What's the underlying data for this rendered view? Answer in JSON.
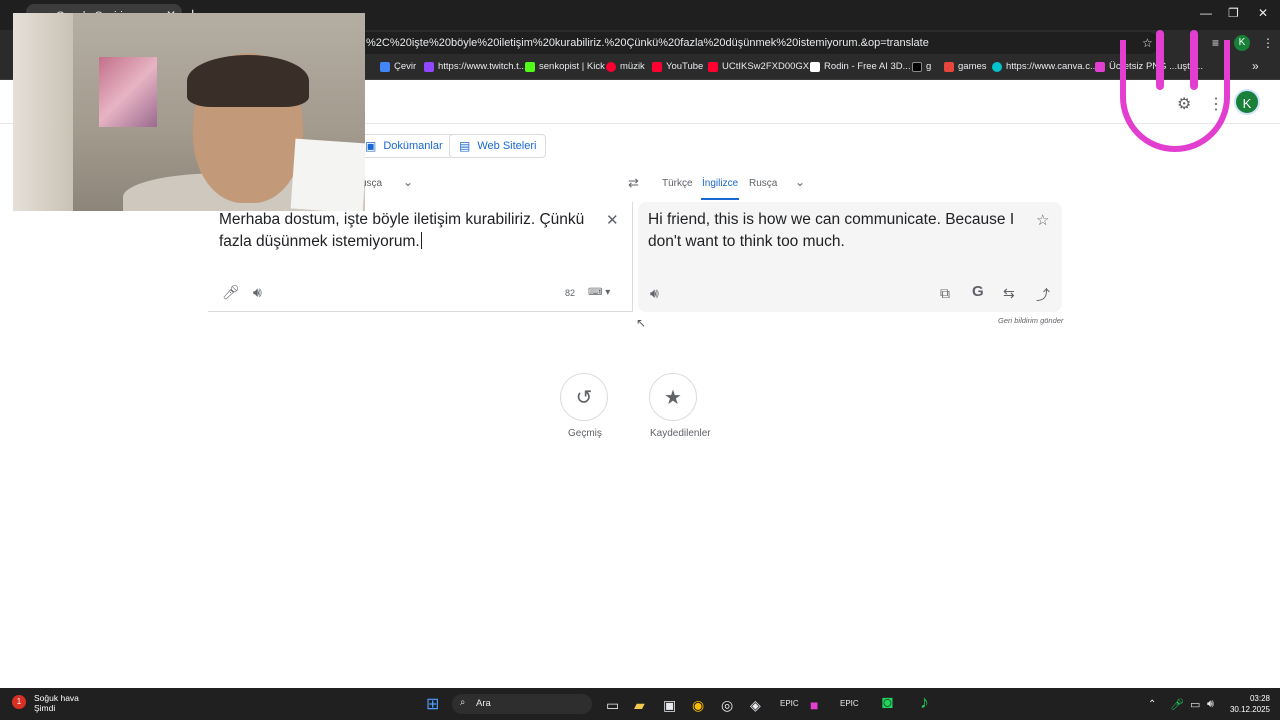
{
  "browser": {
    "tab_title": "Google Çeviri",
    "url": "%2C%20işte%20böyle%20iletişim%20kurabiliriz.%20Çünkü%20fazla%20düşünmek%20istemiyorum.&op=translate",
    "profile_initial": "K",
    "bookmarks": [
      {
        "label": "Çevir",
        "color": "#4285f4"
      },
      {
        "label": "https://www.twitch.t...",
        "color": "#9146ff"
      },
      {
        "label": "senkopist | Kick",
        "color": "#53fc18"
      },
      {
        "label": "müzik",
        "color": "#ff0033"
      },
      {
        "label": "YouTube",
        "color": "#ff0033"
      },
      {
        "label": "UCtIKSw2FXD00GX...",
        "color": "#ff0033"
      },
      {
        "label": "Rodin - Free AI 3D...",
        "color": "#ffffff"
      },
      {
        "label": "g",
        "color": "#000000"
      },
      {
        "label": "games",
        "color": "#e8453c"
      },
      {
        "label": "https://www.canva.c...",
        "color": "#00c4cc"
      },
      {
        "label": "Ücretsiz PNG ...uştu...",
        "color": "#e23fd0"
      }
    ]
  },
  "page": {
    "profile_initial": "K",
    "type_buttons": {
      "documents": "Dokümanlar",
      "websites": "Web Siteleri"
    },
    "source_lang_partial": "usça",
    "target_langs": [
      "Türkçe",
      "İngilizce",
      "Rusça"
    ],
    "active_target": "İngilizce",
    "source_text": "Merhaba dostum, işte böyle iletişim kurabiliriz. Çünkü fazla düşünmek istemiyorum.",
    "char_count": "82",
    "translated_text": "Hi friend, this is how we can communicate. Because I don't want to think too much.",
    "feedback": "Geri bildirim gönder",
    "history_label": "Geçmiş",
    "saved_label": "Kaydedilenler"
  },
  "taskbar": {
    "weather_title": "Soğuk hava",
    "weather_sub": "Şimdi",
    "weather_badge": "1",
    "search_placeholder": "Ara",
    "time": "03:28",
    "date": "30.12.2025"
  },
  "colors": {
    "accent": "#1967d2",
    "overlay_pink": "#e23fd0",
    "avatar_green": "#188038"
  }
}
